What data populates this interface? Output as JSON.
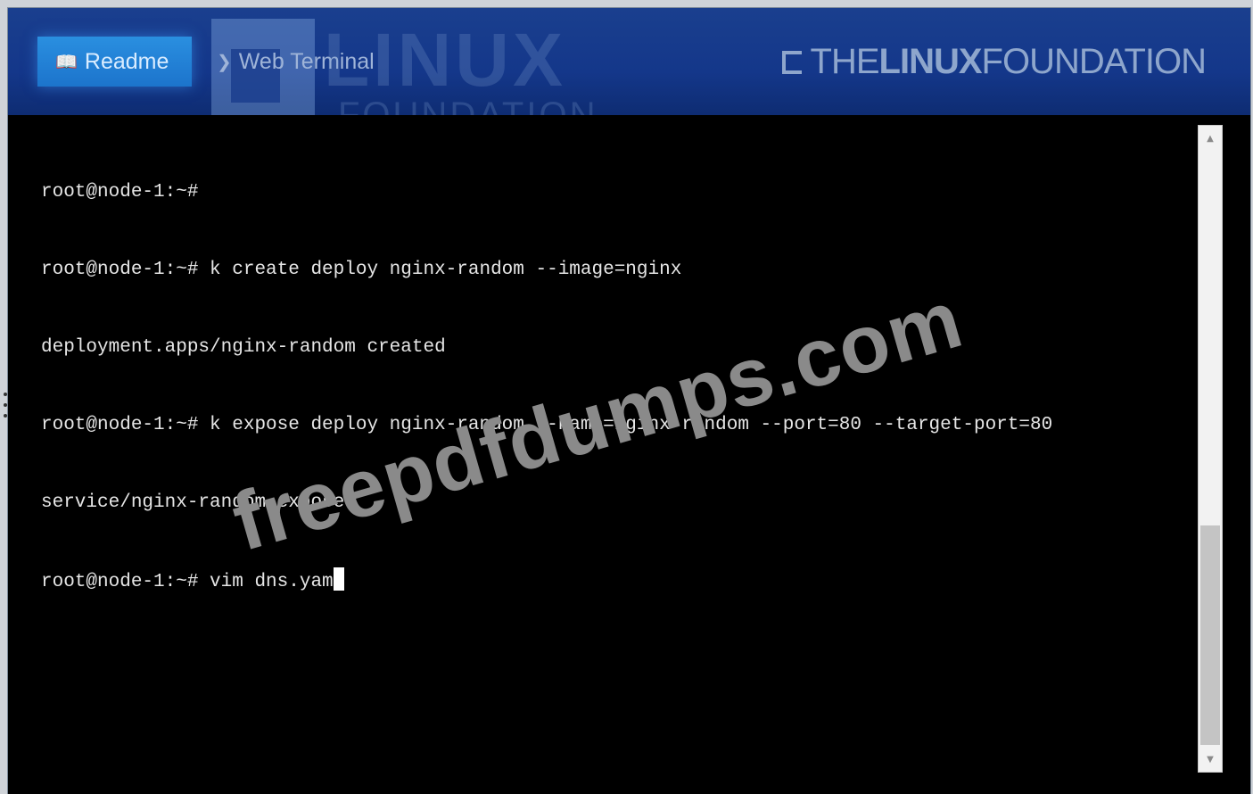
{
  "tabs": [
    {
      "label": "Readme",
      "icon": "book-icon",
      "active": true
    },
    {
      "label": "Web Terminal",
      "icon": "terminal-icon",
      "active": false
    }
  ],
  "brand": {
    "part1": "THE",
    "part2": "LINUX",
    "part3": "FOUNDATION"
  },
  "watermark_logo": {
    "line1": "LINUX",
    "line2": "FOUNDATION"
  },
  "terminal": {
    "lines": [
      "root@node-1:~#",
      "root@node-1:~# k create deploy nginx-random --image=nginx",
      "deployment.apps/nginx-random created",
      "root@node-1:~# k expose deploy nginx-random --name=nginx-random --port=80 --target-port=80",
      "service/nginx-random exposed",
      "root@node-1:~# vim dns.yam"
    ]
  },
  "watermark": "freepdfdumps.com",
  "colors": {
    "header": "#14378a",
    "active_tab": "#1c74cc",
    "terminal_bg": "#000000",
    "terminal_text": "#e6e6e6"
  }
}
